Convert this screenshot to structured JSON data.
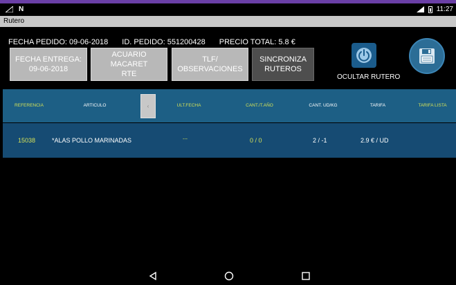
{
  "status_bar": {
    "left_indicator": "N",
    "network": "LTE",
    "time": "11:27"
  },
  "app": {
    "title": "Rutero"
  },
  "order_info": {
    "fecha_pedido": "FECHA PEDIDO: 09-06-2018",
    "id_pedido": "ID. PEDIDO: 551200428",
    "precio_total": "PRECIO TOTAL: 5.8 €"
  },
  "buttons": {
    "fecha_entrega_line1": "FECHA ENTREGA:",
    "fecha_entrega_line2": "09-06-2018",
    "client_line1": "ACUARIO MACARET",
    "client_line2": "RTE",
    "tlf_line1": "TLF/",
    "tlf_line2": "OBSERVACIONES",
    "sync_line1": "SINCRONIZA",
    "sync_line2": "RUTEROS",
    "ocultar_rutero": "OCULTAR RUTERO"
  },
  "table": {
    "headers": [
      "REFERENCIA",
      "ARTICULO",
      "ULT.FECHA",
      "CANT./T.AÑO",
      "CANT. UD/KG",
      "TARIFA",
      "TARIFA LISTA"
    ],
    "rows": [
      {
        "referencia": "15038",
        "articulo": "*ALAS POLLO MARINADAS",
        "ult_fecha": "---",
        "cant_ano": "0 / 0",
        "cant_ud": "2 / -1",
        "tarifa": "2.9 € / UD"
      }
    ]
  },
  "colors": {
    "header_bg": "#1d5f85",
    "row_bg": "#164b73",
    "accent_yellow": "#d4e157",
    "title_bar": "#c8c8c8",
    "top_strip": "#6a3fa6"
  },
  "icons": {
    "power": "power-icon",
    "save": "floppy-disk-icon",
    "back": "nav-back-icon",
    "home": "nav-home-icon",
    "recent": "nav-recent-icon"
  }
}
